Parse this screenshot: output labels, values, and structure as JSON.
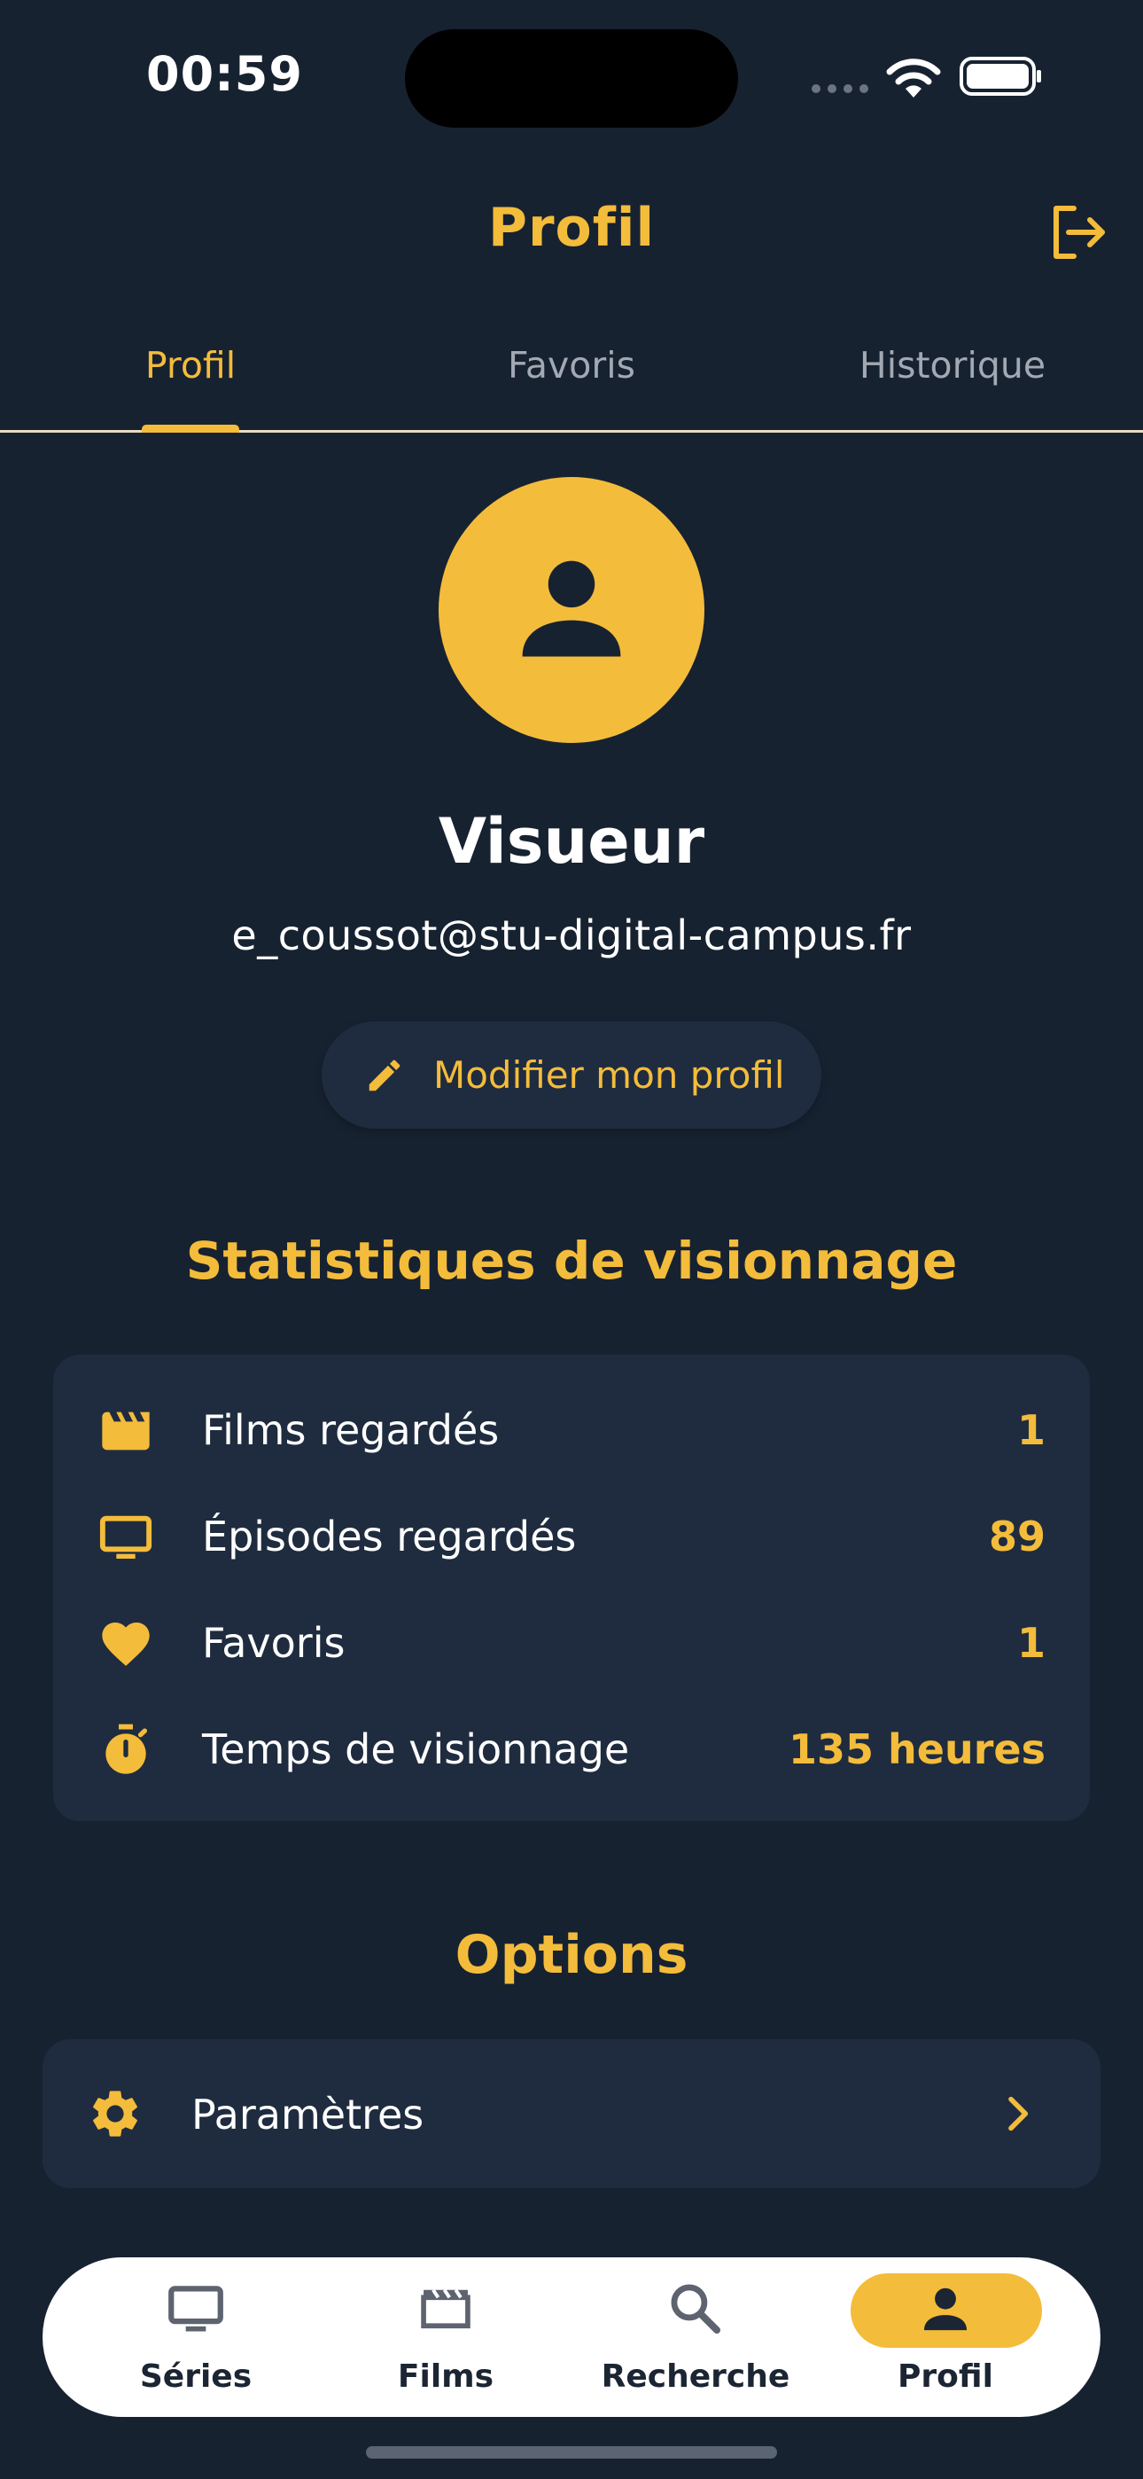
{
  "status_bar": {
    "time": "00:59"
  },
  "header": {
    "title": "Profil"
  },
  "tabs": [
    {
      "label": "Profil",
      "active": true
    },
    {
      "label": "Favoris",
      "active": false
    },
    {
      "label": "Historique",
      "active": false
    }
  ],
  "profile": {
    "name": "Visueur",
    "email": "e_coussot@stu-digital-campus.fr",
    "edit_label": "Modifier mon profil"
  },
  "stats": {
    "title": "Statistiques de visionnage",
    "rows": [
      {
        "icon": "clapperboard-icon",
        "label": "Films regardés",
        "value": "1"
      },
      {
        "icon": "tv-icon",
        "label": "Épisodes regardés",
        "value": "89"
      },
      {
        "icon": "heart-icon",
        "label": "Favoris",
        "value": "1"
      },
      {
        "icon": "timer-icon",
        "label": "Temps de visionnage",
        "value": "135 heures"
      }
    ]
  },
  "options": {
    "title": "Options",
    "items": [
      {
        "icon": "gear-icon",
        "label": "Paramètres"
      }
    ]
  },
  "bottom_nav": {
    "items": [
      {
        "icon": "tv-icon",
        "label": "Séries",
        "active": false
      },
      {
        "icon": "clapperboard-icon",
        "label": "Films",
        "active": false
      },
      {
        "icon": "search-icon",
        "label": "Recherche",
        "active": false
      },
      {
        "icon": "person-icon",
        "label": "Profil",
        "active": true
      }
    ]
  },
  "colors": {
    "background": "#172231",
    "card": "#1f2c3f",
    "accent": "#f4bc3b",
    "text": "#ffffff",
    "muted": "#a2a9b3"
  }
}
